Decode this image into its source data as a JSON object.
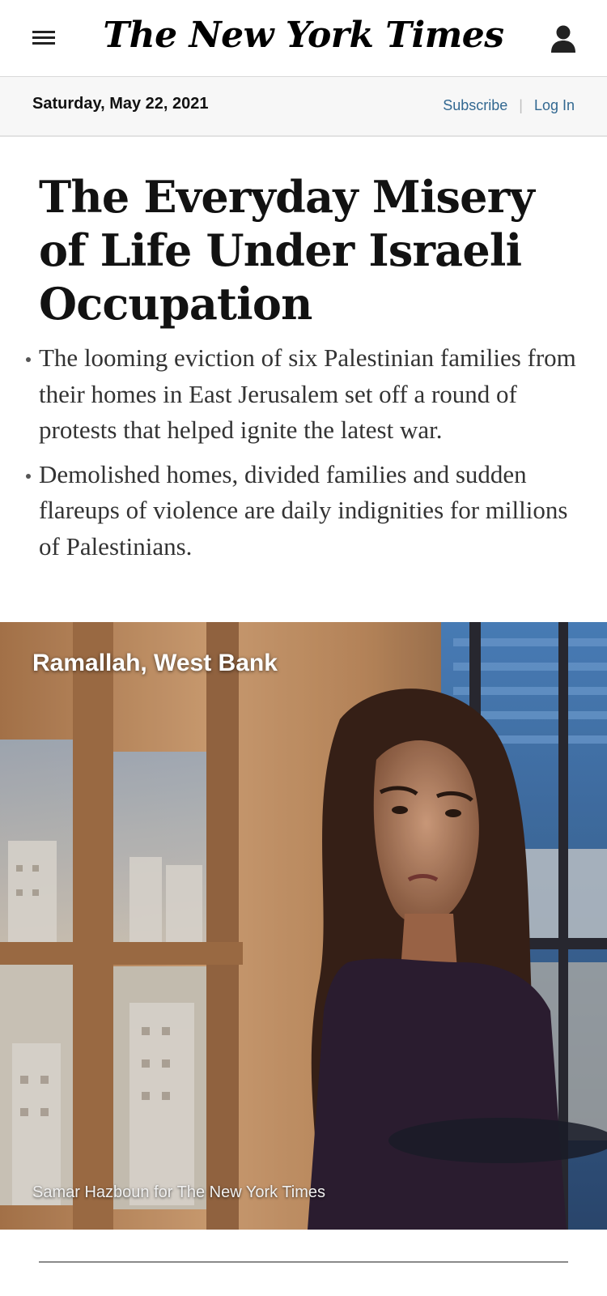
{
  "header": {
    "logo_text": "The New York Times",
    "menu_icon": "hamburger-icon",
    "user_icon": "user-icon"
  },
  "datebar": {
    "date": "Saturday, May 22, 2021",
    "subscribe_label": "Subscribe",
    "separator": "|",
    "login_label": "Log In"
  },
  "article": {
    "headline": "The Everyday Misery of Life Under Israeli Occupation",
    "summary": [
      "The looming eviction of six Palestinian families from their homes in East Jerusalem set off a round of protests that helped ignite the latest war.",
      "Demolished homes, divided families and sudden flareups of violence are daily indignities for millions of Palestinians."
    ],
    "photo": {
      "dateline": "Ramallah, West Bank",
      "credit": "Samar Hazboun for The New York Times"
    }
  },
  "colors": {
    "link": "#326891",
    "headline": "#121212",
    "datebar_bg": "#f7f7f7"
  }
}
